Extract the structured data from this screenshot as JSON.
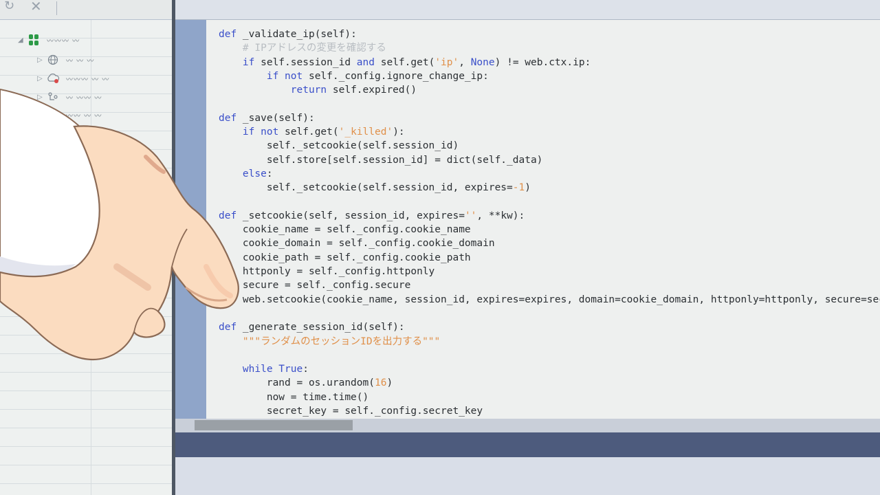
{
  "toolbar": {
    "refresh_icon": "↻",
    "close_icon": "✕"
  },
  "tree": {
    "root": {
      "label": "〰〰〰 〰"
    },
    "items": [
      {
        "label": "〰 〰 〰"
      },
      {
        "label": "〰〰〰 〰 〰"
      },
      {
        "label": "〰 〰〰 〰"
      },
      {
        "label": "〰〰 〰 〰"
      }
    ]
  },
  "colors": {
    "gutter": "#8fa5c9",
    "keyword": "#3a4fc9",
    "string": "#e0904a",
    "comment": "#b8bdc2",
    "tree_root_icon": "#2d9a47"
  },
  "code": [
    [
      {
        "t": "def",
        "c": "kw"
      },
      {
        "t": " _validate_ip(self):"
      }
    ],
    [
      {
        "t": "    # IPアドレスの変更を確認する",
        "c": "cmt"
      }
    ],
    [
      {
        "t": "    "
      },
      {
        "t": "if",
        "c": "kw"
      },
      {
        "t": " self.session_id "
      },
      {
        "t": "and",
        "c": "kw"
      },
      {
        "t": " self.get("
      },
      {
        "t": "'ip'",
        "c": "str"
      },
      {
        "t": ", "
      },
      {
        "t": "None",
        "c": "kw"
      },
      {
        "t": ") != web.ctx.ip:"
      }
    ],
    [
      {
        "t": "        "
      },
      {
        "t": "if not",
        "c": "kw"
      },
      {
        "t": " self._config.ignore_change_ip:"
      }
    ],
    [
      {
        "t": "            "
      },
      {
        "t": "return",
        "c": "kw"
      },
      {
        "t": " self.expired()"
      }
    ],
    [
      {
        "t": ""
      }
    ],
    [
      {
        "t": "def",
        "c": "kw"
      },
      {
        "t": " _save(self):"
      }
    ],
    [
      {
        "t": "    "
      },
      {
        "t": "if not",
        "c": "kw"
      },
      {
        "t": " self.get("
      },
      {
        "t": "'_killed'",
        "c": "str"
      },
      {
        "t": "):"
      }
    ],
    [
      {
        "t": "        self._setcookie(self.session_id)"
      }
    ],
    [
      {
        "t": "        self.store[self.session_id] = dict(self._data)"
      }
    ],
    [
      {
        "t": "    "
      },
      {
        "t": "else",
        "c": "kw"
      },
      {
        "t": ":"
      }
    ],
    [
      {
        "t": "        self._setcookie(self.session_id, expires="
      },
      {
        "t": "-1",
        "c": "num"
      },
      {
        "t": ")"
      }
    ],
    [
      {
        "t": ""
      }
    ],
    [
      {
        "t": "def",
        "c": "kw"
      },
      {
        "t": " _setcookie(self, session_id, expires="
      },
      {
        "t": "''",
        "c": "str"
      },
      {
        "t": ", **kw):"
      }
    ],
    [
      {
        "t": "    cookie_name = self._config.cookie_name"
      }
    ],
    [
      {
        "t": "    cookie_domain = self._config.cookie_domain"
      }
    ],
    [
      {
        "t": "    cookie_path = self._config.cookie_path"
      }
    ],
    [
      {
        "t": "    httponly = self._config.httponly"
      }
    ],
    [
      {
        "t": "    secure = self._config.secure"
      }
    ],
    [
      {
        "t": "    web.setcookie(cookie_name, session_id, expires=expires, domain=cookie_domain, httponly=httponly, secure=secure)"
      }
    ],
    [
      {
        "t": ""
      }
    ],
    [
      {
        "t": "def",
        "c": "kw"
      },
      {
        "t": " _generate_session_id(self):"
      }
    ],
    [
      {
        "t": "    \"\"\"ランダムのセッションIDを出力する\"\"\"",
        "c": "str"
      }
    ],
    [
      {
        "t": ""
      }
    ],
    [
      {
        "t": "    "
      },
      {
        "t": "while True",
        "c": "kw"
      },
      {
        "t": ":"
      }
    ],
    [
      {
        "t": "        rand = os.urandom("
      },
      {
        "t": "16",
        "c": "num"
      },
      {
        "t": ")"
      }
    ],
    [
      {
        "t": "        now = time.time()"
      }
    ],
    [
      {
        "t": "        secret_key = self._config.secret_key"
      }
    ]
  ]
}
